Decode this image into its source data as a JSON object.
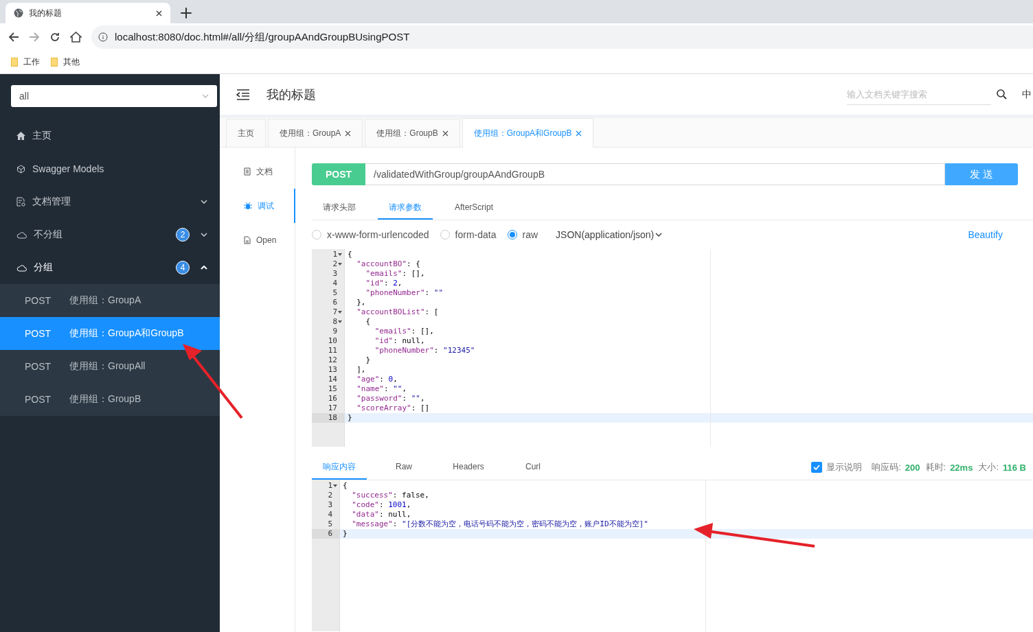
{
  "browser": {
    "tab_title": "我的标题",
    "address": "localhost:8080/doc.html#/all/分组/groupAAndGroupBUsingPOST",
    "bookmarks": [
      "工作",
      "其他"
    ]
  },
  "sidebar": {
    "group_select": "all",
    "items": [
      {
        "label": "主页"
      },
      {
        "label": "Swagger Models"
      },
      {
        "label": "文档管理",
        "expanded": false
      },
      {
        "label": "不分组",
        "badge": "2",
        "expanded": false
      },
      {
        "label": "分组",
        "badge": "4",
        "expanded": true,
        "children": [
          {
            "method": "POST",
            "label": "使用组：GroupA",
            "selected": false
          },
          {
            "method": "POST",
            "label": "使用组：GroupA和GroupB",
            "selected": true
          },
          {
            "method": "POST",
            "label": "使用组：GroupAll",
            "selected": false
          },
          {
            "method": "POST",
            "label": "使用组：GroupB",
            "selected": false
          }
        ]
      }
    ]
  },
  "header": {
    "title": "我的标题",
    "search_placeholder": "输入文档关键字搜索",
    "language": "中"
  },
  "tabs": [
    {
      "label": "主页",
      "closable": false,
      "selected": false
    },
    {
      "label": "使用组：GroupA",
      "closable": true,
      "selected": false
    },
    {
      "label": "使用组：GroupB",
      "closable": true,
      "selected": false
    },
    {
      "label": "使用组：GroupA和GroupB",
      "closable": true,
      "selected": true
    }
  ],
  "side_tabs": [
    {
      "label": "文档",
      "selected": false
    },
    {
      "label": "调试",
      "selected": true
    },
    {
      "label": "Open",
      "selected": false
    }
  ],
  "request": {
    "method": "POST",
    "url": "/validatedWithGroup/groupAAndGroupB",
    "send": "发 送",
    "tabs": [
      {
        "label": "请求头部",
        "selected": false
      },
      {
        "label": "请求参数",
        "selected": true
      },
      {
        "label": "AfterScript",
        "selected": false
      }
    ],
    "body_types": [
      {
        "label": "x-www-form-urlencoded",
        "selected": false
      },
      {
        "label": "form-data",
        "selected": false
      },
      {
        "label": "raw",
        "selected": true
      }
    ],
    "content_type": "JSON(application/json)",
    "beautify": "Beautify",
    "lines": [
      {
        "number": "1",
        "fold": true,
        "active": false,
        "tokens": [
          {
            "kind": "punct",
            "text": "{"
          }
        ]
      },
      {
        "number": "2",
        "fold": true,
        "active": false,
        "tokens": [
          {
            "kind": "key",
            "text": "  \"accountBO\""
          },
          {
            "kind": "punct",
            "text": ": {"
          }
        ]
      },
      {
        "number": "3",
        "fold": false,
        "active": false,
        "tokens": [
          {
            "kind": "key",
            "text": "    \"emails\""
          },
          {
            "kind": "punct",
            "text": ": [],"
          }
        ]
      },
      {
        "number": "4",
        "fold": false,
        "active": false,
        "tokens": [
          {
            "kind": "key",
            "text": "    \"id\""
          },
          {
            "kind": "punct",
            "text": ": "
          },
          {
            "kind": "number",
            "text": "2"
          },
          {
            "kind": "punct",
            "text": ","
          }
        ]
      },
      {
        "number": "5",
        "fold": false,
        "active": false,
        "tokens": [
          {
            "kind": "key",
            "text": "    \"phoneNumber\""
          },
          {
            "kind": "punct",
            "text": ": "
          },
          {
            "kind": "string",
            "text": "\"\""
          }
        ]
      },
      {
        "number": "6",
        "fold": false,
        "active": false,
        "tokens": [
          {
            "kind": "punct",
            "text": "  },"
          }
        ]
      },
      {
        "number": "7",
        "fold": true,
        "active": false,
        "tokens": [
          {
            "kind": "key",
            "text": "  \"accountBOList\""
          },
          {
            "kind": "punct",
            "text": ": ["
          }
        ]
      },
      {
        "number": "8",
        "fold": true,
        "active": false,
        "tokens": [
          {
            "kind": "punct",
            "text": "    {"
          }
        ]
      },
      {
        "number": "9",
        "fold": false,
        "active": false,
        "tokens": [
          {
            "kind": "key",
            "text": "      \"emails\""
          },
          {
            "kind": "punct",
            "text": ": [],"
          }
        ]
      },
      {
        "number": "10",
        "fold": false,
        "active": false,
        "tokens": [
          {
            "kind": "key",
            "text": "      \"id\""
          },
          {
            "kind": "punct",
            "text": ": null,"
          }
        ]
      },
      {
        "number": "11",
        "fold": false,
        "active": false,
        "tokens": [
          {
            "kind": "key",
            "text": "      \"phoneNumber\""
          },
          {
            "kind": "punct",
            "text": ": "
          },
          {
            "kind": "string",
            "text": "\"12345\""
          }
        ]
      },
      {
        "number": "12",
        "fold": false,
        "active": false,
        "tokens": [
          {
            "kind": "punct",
            "text": "    }"
          }
        ]
      },
      {
        "number": "13",
        "fold": false,
        "active": false,
        "tokens": [
          {
            "kind": "punct",
            "text": "  ],"
          }
        ]
      },
      {
        "number": "14",
        "fold": false,
        "active": false,
        "tokens": [
          {
            "kind": "key",
            "text": "  \"age\""
          },
          {
            "kind": "punct",
            "text": ": "
          },
          {
            "kind": "number",
            "text": "0"
          },
          {
            "kind": "punct",
            "text": ","
          }
        ]
      },
      {
        "number": "15",
        "fold": false,
        "active": false,
        "tokens": [
          {
            "kind": "key",
            "text": "  \"name\""
          },
          {
            "kind": "punct",
            "text": ": "
          },
          {
            "kind": "string",
            "text": "\"\""
          },
          {
            "kind": "punct",
            "text": ","
          }
        ]
      },
      {
        "number": "16",
        "fold": false,
        "active": false,
        "tokens": [
          {
            "kind": "key",
            "text": "  \"password\""
          },
          {
            "kind": "punct",
            "text": ": "
          },
          {
            "kind": "string",
            "text": "\"\""
          },
          {
            "kind": "punct",
            "text": ","
          }
        ]
      },
      {
        "number": "17",
        "fold": false,
        "active": false,
        "tokens": [
          {
            "kind": "key",
            "text": "  \"scoreArray\""
          },
          {
            "kind": "punct",
            "text": ": []"
          }
        ]
      },
      {
        "number": "18",
        "fold": false,
        "active": true,
        "tokens": [
          {
            "kind": "punct",
            "text": "}"
          }
        ]
      }
    ]
  },
  "response": {
    "tabs": [
      {
        "label": "响应内容",
        "selected": true
      },
      {
        "label": "Raw",
        "selected": false
      },
      {
        "label": "Headers",
        "selected": false
      },
      {
        "label": "Curl",
        "selected": false
      }
    ],
    "show_description": {
      "label": "显示说明",
      "checked": true
    },
    "stats": [
      {
        "label": "响应码:",
        "value": "200"
      },
      {
        "label": "耗时:",
        "value": "22ms"
      },
      {
        "label": "大小:",
        "value": "116 B"
      }
    ],
    "lines": [
      {
        "number": "1",
        "fold": true,
        "active": false,
        "tokens": [
          {
            "kind": "punct",
            "text": "{"
          }
        ]
      },
      {
        "number": "2",
        "fold": false,
        "active": false,
        "tokens": [
          {
            "kind": "key",
            "text": "  \"success\""
          },
          {
            "kind": "punct",
            "text": ": false,"
          }
        ]
      },
      {
        "number": "3",
        "fold": false,
        "active": false,
        "tokens": [
          {
            "kind": "key",
            "text": "  \"code\""
          },
          {
            "kind": "punct",
            "text": ": "
          },
          {
            "kind": "number",
            "text": "1001"
          },
          {
            "kind": "punct",
            "text": ","
          }
        ]
      },
      {
        "number": "4",
        "fold": false,
        "active": false,
        "tokens": [
          {
            "kind": "key",
            "text": "  \"data\""
          },
          {
            "kind": "punct",
            "text": ": null,"
          }
        ]
      },
      {
        "number": "5",
        "fold": false,
        "active": false,
        "tokens": [
          {
            "kind": "key",
            "text": "  \"message\""
          },
          {
            "kind": "punct",
            "text": ": "
          },
          {
            "kind": "string",
            "text": "\"[分数不能为空，电话号码不能为空，密码不能为空，账户ID不能为空]\""
          }
        ]
      },
      {
        "number": "6",
        "fold": false,
        "active": true,
        "tokens": [
          {
            "kind": "punct",
            "text": "}"
          }
        ]
      }
    ]
  },
  "annotations": [
    {
      "kind": "arrow"
    },
    {
      "kind": "arrow"
    }
  ]
}
